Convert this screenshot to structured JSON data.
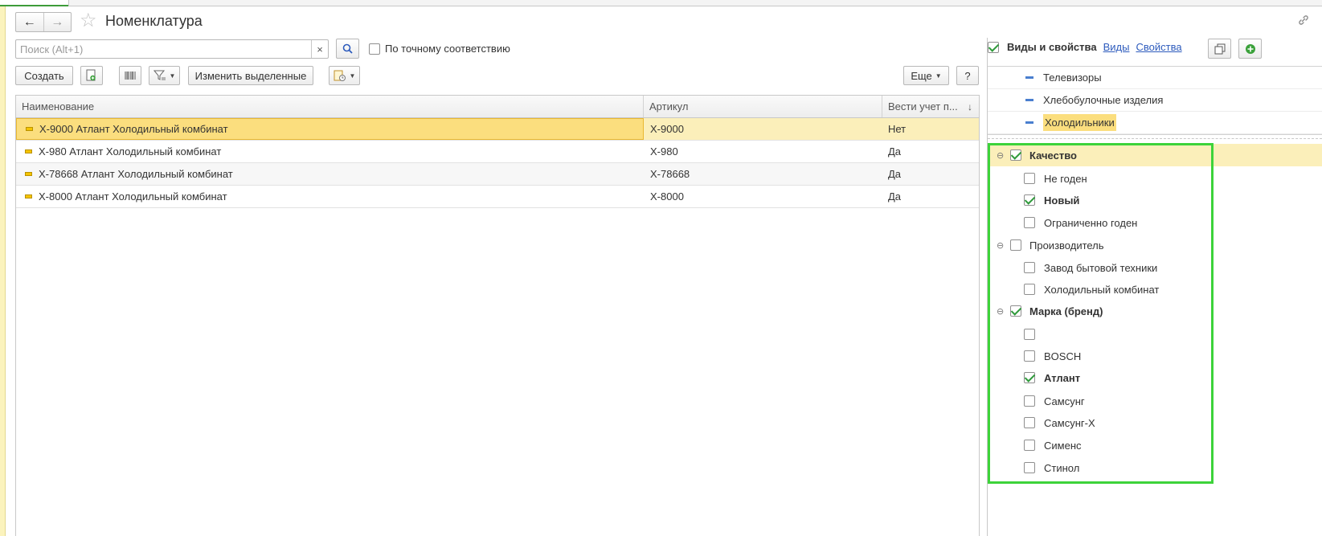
{
  "colors": {
    "accent_green": "#3dd33a",
    "selection": "#fbde7e",
    "link": "#2d5bbd"
  },
  "page": {
    "title": "Номенклатура"
  },
  "nav": {
    "back_icon": "←",
    "forward_icon": "→",
    "star_icon": "☆",
    "link_icon": "🔗"
  },
  "search": {
    "placeholder": "Поиск (Alt+1)",
    "value": "",
    "clear_icon": "×",
    "search_icon": "🔍"
  },
  "exact_match": {
    "label": "По точному соответствию",
    "checked": false
  },
  "toolbar": {
    "create_label": "Создать",
    "copy_icon": "⧉",
    "barcode_icon": "▥",
    "filter_icon": "⛛",
    "change_selected_label": "Изменить выделенные",
    "report_icon": "📄",
    "more_label": "Еще",
    "help_label": "?",
    "dropdown_caret": "▼"
  },
  "table": {
    "columns": [
      "Наименование",
      "Артикул",
      "Вести учет п..."
    ],
    "sort_indicator": "↓",
    "rows": [
      {
        "name": "X-9000 Атлант Холодильный комбинат",
        "article": "X-9000",
        "track": "Нет"
      },
      {
        "name": "X-980 Атлант Холодильный комбинат",
        "article": "X-980",
        "track": "Да"
      },
      {
        "name": "X-78668 Атлант Холодильный комбинат",
        "article": "X-78668",
        "track": "Да"
      },
      {
        "name": "X-8000 Атлант Холодильный комбинат",
        "article": "X-8000",
        "track": "Да"
      }
    ]
  },
  "panel": {
    "title": "Виды и свойства",
    "kinds_link": "Виды",
    "properties_link": "Свойства",
    "enabled": true,
    "kinds": [
      "Телевизоры",
      "Хлебобулочные изделия",
      "Холодильники"
    ],
    "selected_kind": "Холодильники",
    "properties": [
      {
        "type": "group",
        "label": "Качество",
        "checked": true
      },
      {
        "type": "value",
        "label": "Не годен",
        "checked": false
      },
      {
        "type": "value",
        "label": "Новый",
        "checked": true
      },
      {
        "type": "value",
        "label": "Ограниченно годен",
        "checked": false
      },
      {
        "type": "group",
        "label": "Производитель",
        "checked": false
      },
      {
        "type": "value",
        "label": "Завод бытовой техники",
        "checked": false
      },
      {
        "type": "value",
        "label": "Холодильный комбинат",
        "checked": false
      },
      {
        "type": "group",
        "label": "Марка (бренд)",
        "checked": true
      },
      {
        "type": "value",
        "label": "",
        "checked": false
      },
      {
        "type": "value",
        "label": "BOSCH",
        "checked": false
      },
      {
        "type": "value",
        "label": "Атлант",
        "checked": true
      },
      {
        "type": "value",
        "label": "Самсунг",
        "checked": false
      },
      {
        "type": "value",
        "label": "Самсунг-Х",
        "checked": false
      },
      {
        "type": "value",
        "label": "Сименс",
        "checked": false
      },
      {
        "type": "value",
        "label": "Стинол",
        "checked": false
      }
    ],
    "collapse_icon": "⊖",
    "copy_icon": "⧉",
    "add_icon": "+"
  }
}
